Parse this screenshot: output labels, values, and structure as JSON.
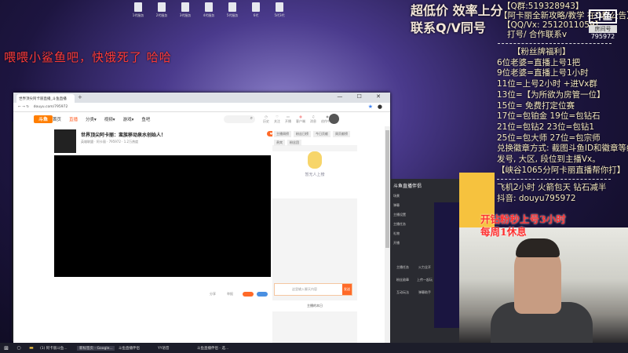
{
  "desktop": {
    "icons": [
      "1代服务",
      "2代服务",
      "3代服务",
      "4代服务",
      "5代服务",
      "6代",
      "5代3代"
    ]
  },
  "stream_overlay": {
    "red_caption": "喂喂小鲨鱼吧，快饿死了 哈哈",
    "headline": [
      "超低价 效率上分",
      "联系Q/V同号"
    ],
    "contact": [
      "【Q群:519328943】",
      "【阿卡丽全新攻略/教学 在Q群公告】",
      "【QQ/Vx: 2512011059】",
      "打号/ 合作联系v"
    ],
    "room_logo": {
      "top": "斗鱼",
      "label": "房间号",
      "number": "795972"
    },
    "fan_title": "【粉丝牌福利】",
    "fan_rules": [
      "6位老婆=直播上号1把",
      "9位老婆=直播上号1小时",
      "11位=上号2小时  +进Vx群",
      "13位=【为所欲为房管一位】",
      "15位= 免费打定位赛",
      "17位=包铂金   19位=包钻石",
      "21位=包钻2     23位=包钻1",
      "25位=包大师   27位=包宗师",
      "兑换徽章方式: 截图斗鱼ID和徽章等级",
      "发号, 大区, 段位到主播Vx。",
      "【峡谷1065分阿卡丽直播帮你打】"
    ],
    "promo": [
      "飞机2小时  火箭包天  钻石减半",
      "抖音: douyu795972"
    ],
    "schedule": [
      "开钻粉秒上号3小时",
      "每周1休息"
    ]
  },
  "browser": {
    "tab_title": "世界顶尖阿卡丽直播_斗鱼直播",
    "url": "douyu.com/795972",
    "window_controls": "— ☐ ✕",
    "nav": {
      "logo": "斗鱼",
      "items": [
        "首页",
        "直播",
        "分类▾",
        "视频▾",
        "游戏▾",
        "鱼吧"
      ],
      "search_icon": "⌕",
      "header_icons": [
        "历史",
        "关注",
        "开播",
        "客户端",
        "消息",
        "创作中心"
      ]
    },
    "room": {
      "title": "世界顶尖阿卡丽：蛮族移动泉水创始人！",
      "meta": "英雄联盟 · 阿卡丽 · 795972 · 1.2万热度",
      "follow": "♥ 关注"
    },
    "under_video": {
      "share": "分享",
      "report": "举报",
      "btn1": "",
      "btn2": ""
    },
    "right_col": {
      "tabs": [
        "主播周榜",
        "粉丝日榜",
        "今日贡献",
        "周贡献榜",
        "贵宾",
        "粉丝团"
      ],
      "mascot_caption": "暂无人上榜",
      "chat_placeholder": "这里输入聊天内容",
      "send": "发送",
      "footer": "主播的本日"
    }
  },
  "tool_window": {
    "title": "斗鱼直播伴侣",
    "menu": [
      "场景",
      "弹幕",
      "主播设置",
      "主播任务",
      "礼物",
      "开播"
    ],
    "grid": [
      "主播任务",
      "火力全开",
      "粉丝勋章",
      "上传一起玩",
      "互动玩法",
      "弹幕助手"
    ]
  },
  "taskbar": {
    "start": "⊞",
    "tasks": [
      "(1) 阿卡丽斗鱼...",
      "新标签页 - Google...",
      "斗鱼直播伴侣",
      "YY语音",
      "斗鱼直播伴侣 - 选..."
    ]
  }
}
